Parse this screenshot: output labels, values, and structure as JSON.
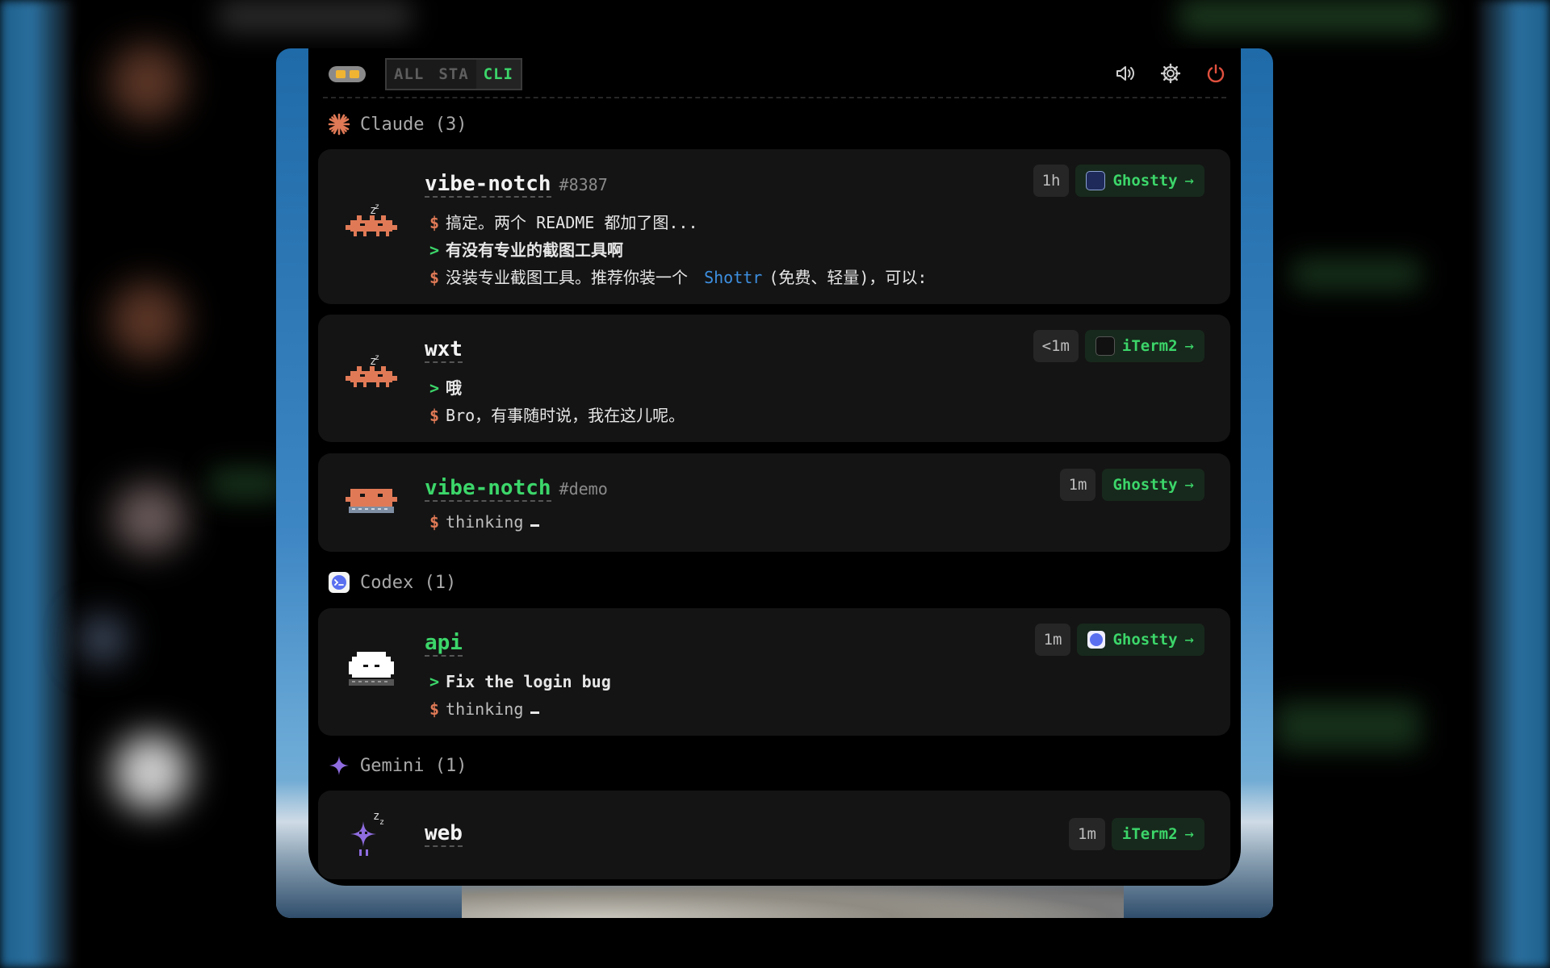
{
  "topbar": {
    "tabs": [
      "ALL",
      "STA",
      "CLI"
    ],
    "active_tab": "CLI"
  },
  "groups": [
    {
      "label": "Claude (3)",
      "icon": "claude-starburst-icon",
      "sessions": [
        {
          "name": "vibe-notch",
          "tag": "#8387",
          "time": "1h",
          "app": "Ghostty",
          "lines": [
            {
              "prompt": "$",
              "text": "搞定。两个 README 都加了图..."
            },
            {
              "prompt": ">",
              "text": "有没有专业的截图工具啊"
            },
            {
              "prompt": "$",
              "pre": "没装专业截图工具。推荐你装一个 ",
              "link": "Shottr",
              "post": "(免费、轻量)，可以:"
            }
          ]
        },
        {
          "name": "wxt",
          "tag": "",
          "time": "<1m",
          "app": "iTerm2",
          "lines": [
            {
              "prompt": ">",
              "text": "哦"
            },
            {
              "prompt": "$",
              "text": "Bro，有事随时说，我在这儿呢。"
            }
          ]
        },
        {
          "name": "vibe-notch",
          "tag": "#demo",
          "time": "1m",
          "app": "Ghostty",
          "lines": [
            {
              "prompt": "$",
              "text": "thinking"
            }
          ]
        }
      ]
    },
    {
      "label": "Codex (1)",
      "icon": "codex-terminal-icon",
      "sessions": [
        {
          "name": "api",
          "tag": "",
          "time": "1m",
          "app": "Ghostty",
          "lines": [
            {
              "prompt": ">",
              "text": "Fix the login bug"
            },
            {
              "prompt": "$",
              "text": "thinking"
            }
          ]
        }
      ]
    },
    {
      "label": "Gemini (1)",
      "icon": "gemini-sparkle-icon",
      "sessions": [
        {
          "name": "web",
          "tag": "",
          "time": "1m",
          "app": "iTerm2",
          "lines": []
        }
      ]
    }
  ],
  "colors": {
    "accent_green": "#3cd66a",
    "prompt_orange": "#e07a56",
    "link_blue": "#3d8fe0"
  }
}
